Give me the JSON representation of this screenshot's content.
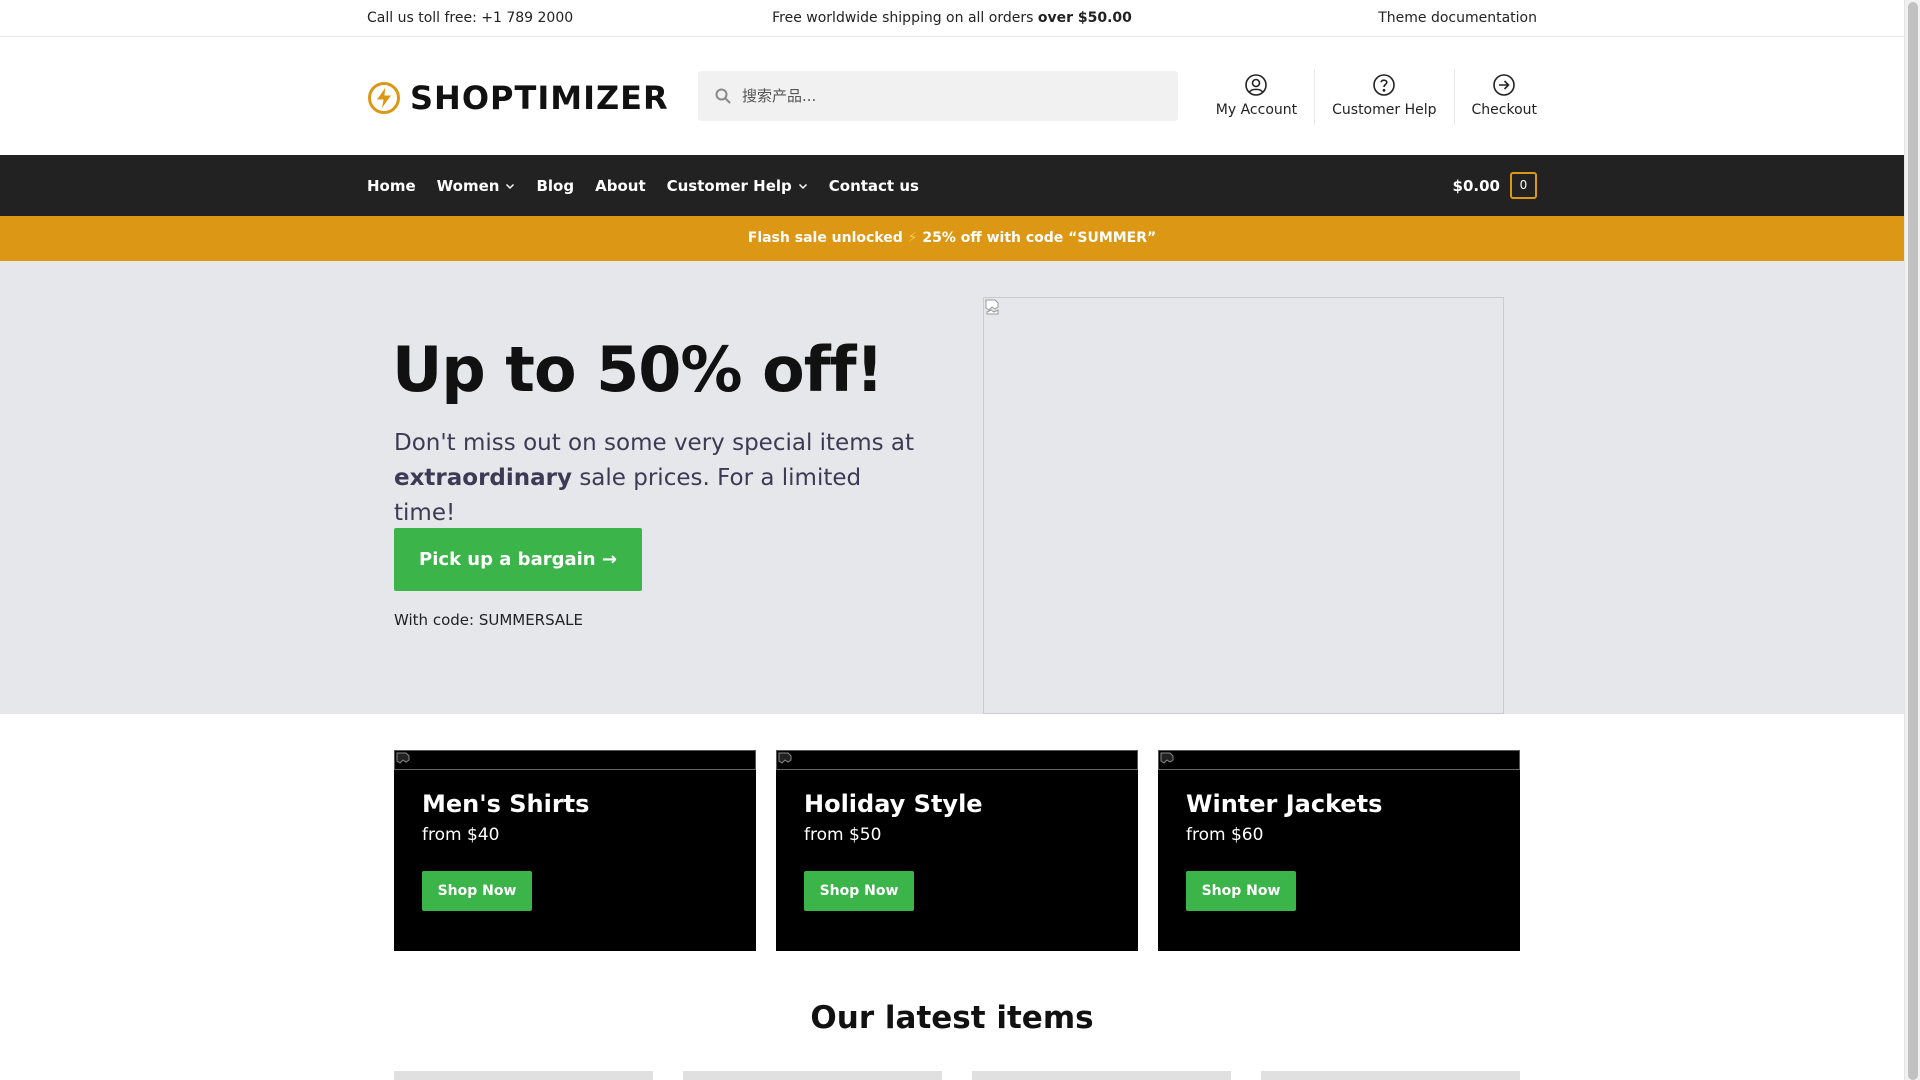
{
  "topbar": {
    "left": "Call us toll free: +1 789 2000",
    "center_prefix": "Free worldwide shipping on all orders ",
    "center_bold": "over $50.00",
    "right": "Theme documentation"
  },
  "header": {
    "logo_text": "SHOPTIMIZER",
    "search_placeholder": "搜索产品...",
    "links": [
      {
        "label": "My Account",
        "icon": "user-circle-icon"
      },
      {
        "label": "Customer Help",
        "icon": "help-circle-icon"
      },
      {
        "label": "Checkout",
        "icon": "arrow-circle-icon"
      }
    ]
  },
  "nav": {
    "items": [
      {
        "label": "Home",
        "dropdown": false
      },
      {
        "label": "Women",
        "dropdown": true
      },
      {
        "label": "Blog",
        "dropdown": false
      },
      {
        "label": "About",
        "dropdown": false
      },
      {
        "label": "Customer Help",
        "dropdown": true
      },
      {
        "label": "Contact us",
        "dropdown": false
      }
    ],
    "cart_total": "$0.00",
    "cart_count": "0"
  },
  "flash": {
    "prefix": "Flash sale unlocked ",
    "bolt": "⚡",
    "suffix": " 25% off with code “SUMMER”"
  },
  "hero": {
    "title": "Up to 50% off!",
    "desc_1": "Don't miss out on some very special items at ",
    "desc_bold": "extraordinary",
    "desc_2": " sale prices. For a limited time!",
    "cta": "Pick up a bargain →",
    "code": "With code: SUMMERSALE"
  },
  "cards": [
    {
      "title": "Men's Shirts",
      "from": "from $40",
      "button": "Shop Now"
    },
    {
      "title": "Holiday Style",
      "from": "from $50",
      "button": "Shop Now"
    },
    {
      "title": "Winter Jackets",
      "from": "from $60",
      "button": "Shop Now"
    }
  ],
  "latest_heading": "Our latest items",
  "colors": {
    "accent_orange": "#dc9814",
    "button_green": "#3bb54a",
    "nav_dark": "#222222",
    "hero_bg": "#e5e7eb"
  }
}
